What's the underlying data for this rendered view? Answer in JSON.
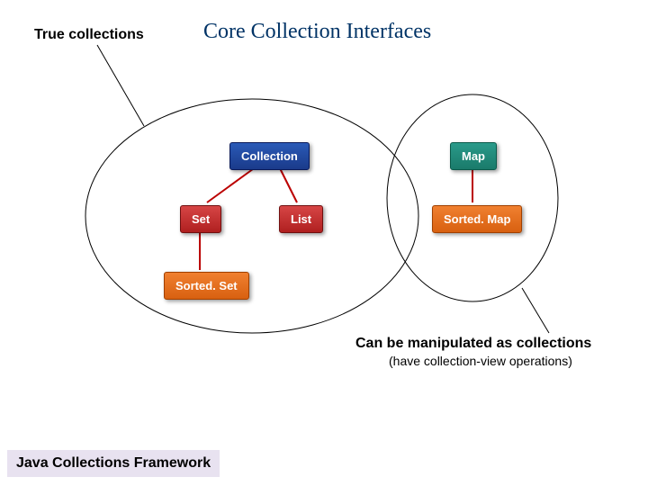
{
  "title": "Core Collection Interfaces",
  "labels": {
    "left": "True collections",
    "right": "Can be manipulated as collections",
    "right_sub": "(have collection-view operations)"
  },
  "nodes": {
    "collection": "Collection",
    "set": "Set",
    "list": "List",
    "sortedset": "Sorted. Set",
    "map": "Map",
    "sortedmap": "Sorted. Map"
  },
  "footer": "Java Collections Framework"
}
